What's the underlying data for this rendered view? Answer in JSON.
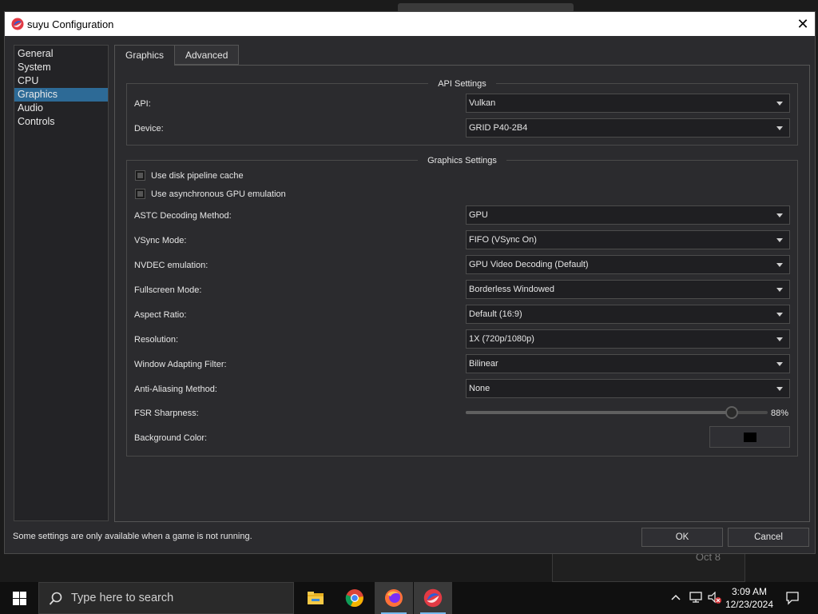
{
  "window": {
    "title": "suyu Configuration",
    "close_glyph": "✕"
  },
  "sidebar": {
    "items": [
      {
        "label": "General"
      },
      {
        "label": "System"
      },
      {
        "label": "CPU"
      },
      {
        "label": "Graphics",
        "active": true
      },
      {
        "label": "Audio"
      },
      {
        "label": "Controls"
      }
    ]
  },
  "tabs": [
    {
      "label": "Graphics",
      "active": true
    },
    {
      "label": "Advanced"
    }
  ],
  "api_settings": {
    "title": "API Settings",
    "api": {
      "label": "API:",
      "value": "Vulkan"
    },
    "device": {
      "label": "Device:",
      "value": "GRID P40-2B4"
    }
  },
  "graphics_settings": {
    "title": "Graphics Settings",
    "disk_cache": {
      "label": "Use disk pipeline cache"
    },
    "async_gpu": {
      "label": "Use asynchronous GPU emulation"
    },
    "astc": {
      "label": "ASTC Decoding Method:",
      "value": "GPU"
    },
    "vsync": {
      "label": "VSync Mode:",
      "value": "FIFO (VSync On)"
    },
    "nvdec": {
      "label": "NVDEC emulation:",
      "value": "GPU Video Decoding (Default)"
    },
    "fullscreen": {
      "label": "Fullscreen Mode:",
      "value": "Borderless Windowed"
    },
    "aspect": {
      "label": "Aspect Ratio:",
      "value": "Default (16:9)"
    },
    "resolution": {
      "label": "Resolution:",
      "value": "1X (720p/1080p)"
    },
    "filter": {
      "label": "Window Adapting Filter:",
      "value": "Bilinear"
    },
    "aa": {
      "label": "Anti-Aliasing Method:",
      "value": "None"
    },
    "fsr": {
      "label": "FSR Sharpness:",
      "value_text": "88%",
      "value": 0.88
    },
    "bg_color": {
      "label": "Background Color:",
      "color": "#000000"
    }
  },
  "footer": {
    "note": "Some settings are only available when a game is not running.",
    "ok_label": "OK",
    "cancel_label": "Cancel"
  },
  "background": {
    "date_card_text": "Oct 8"
  },
  "taskbar": {
    "search_placeholder": "Type here to search",
    "time": "3:09 AM",
    "date": "12/23/2024",
    "apps": [
      "file-explorer-icon",
      "chrome-icon",
      "firefox-icon",
      "suyu-icon"
    ]
  },
  "colors": {
    "accent": "#2d6a96",
    "taskbar_underline": "#76b9ed"
  }
}
